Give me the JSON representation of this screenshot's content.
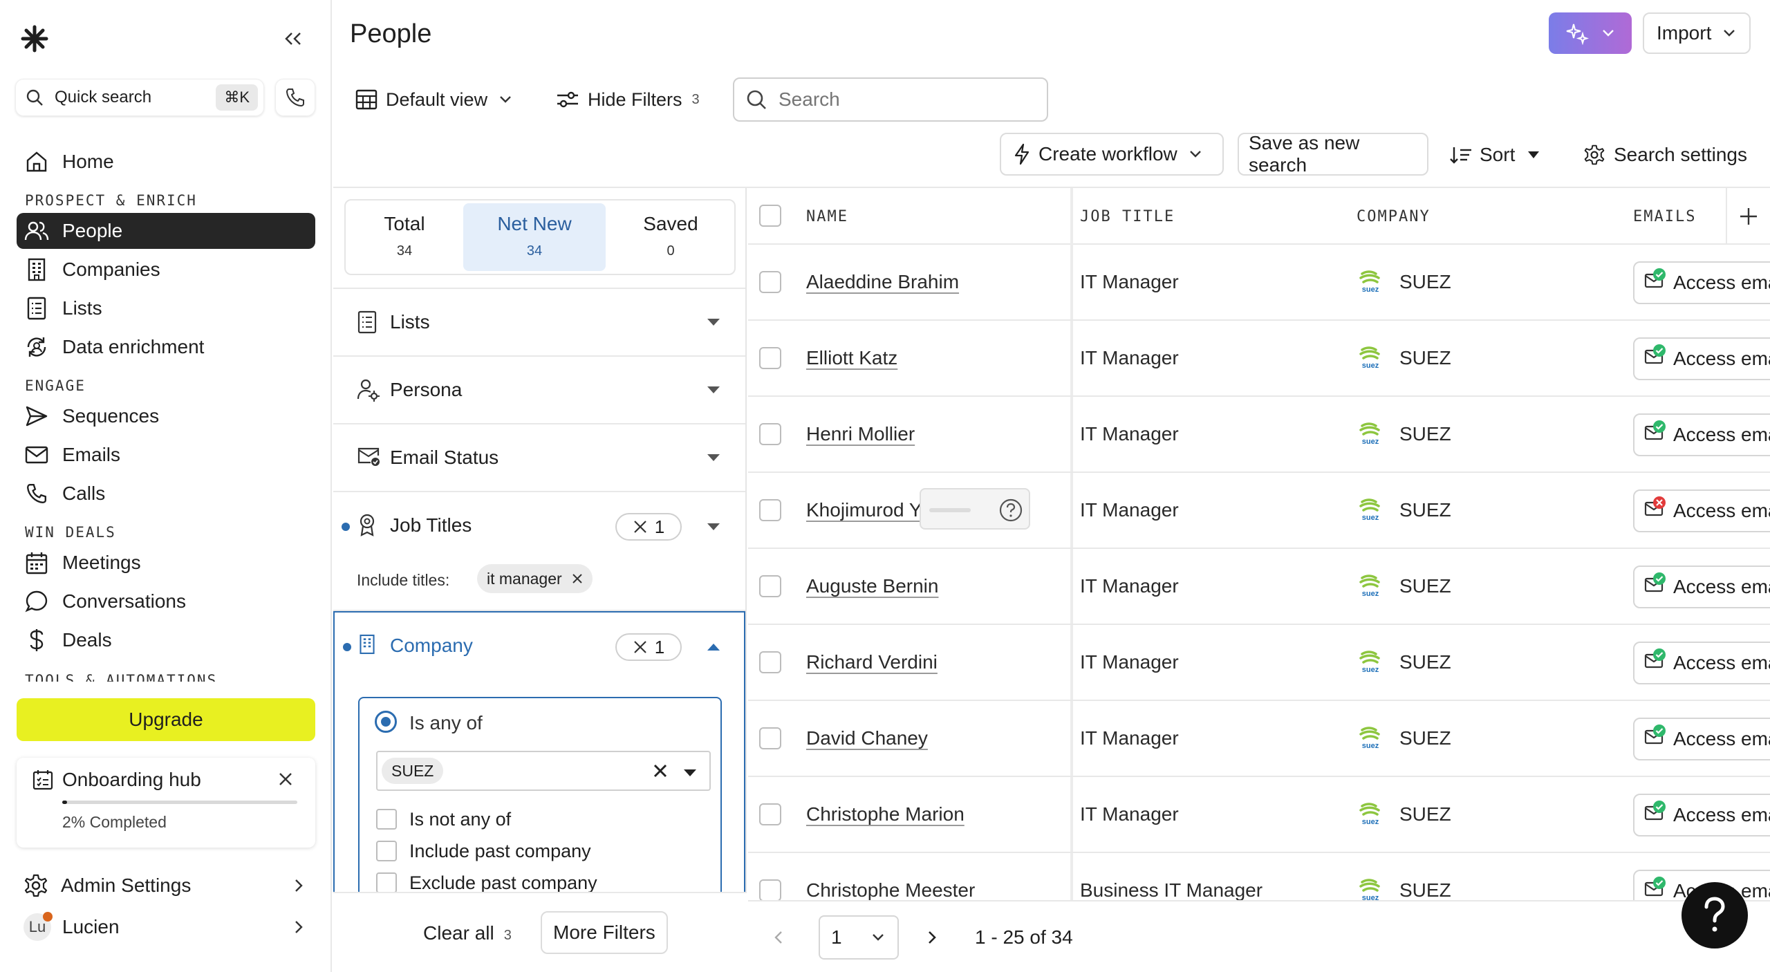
{
  "sidebar": {
    "quick_search_label": "Quick search",
    "quick_search_shortcut": "⌘K",
    "sections": {
      "prospect": "PROSPECT & ENRICH",
      "engage": "ENGAGE",
      "win": "WIN DEALS",
      "tools": "TOOLS & AUTOMATIONS"
    },
    "items": {
      "home": "Home",
      "people": "People",
      "companies": "Companies",
      "lists": "Lists",
      "data_enrichment": "Data enrichment",
      "sequences": "Sequences",
      "emails": "Emails",
      "calls": "Calls",
      "meetings": "Meetings",
      "conversations": "Conversations",
      "deals": "Deals"
    },
    "upgrade_label": "Upgrade",
    "upgrade_color": "#e8f021",
    "onboarding": {
      "title": "Onboarding hub",
      "progress_text": "2% Completed",
      "progress_fraction": 0.02
    },
    "admin_settings": "Admin Settings",
    "user": {
      "initials": "Lu",
      "name": "Lucien"
    }
  },
  "header": {
    "title": "People",
    "import_label": "Import",
    "ai_button_color": "#8b6fe0"
  },
  "toolbar": {
    "view_label": "Default view",
    "hide_filters_label": "Hide Filters",
    "hide_filters_count": "3",
    "search_placeholder": "Search",
    "create_workflow_label": "Create workflow",
    "save_search_label": "Save as new search",
    "sort_label": "Sort",
    "search_settings_label": "Search settings"
  },
  "filters": {
    "tabs": [
      {
        "label": "Total",
        "count": "34"
      },
      {
        "label": "Net New",
        "count": "34"
      },
      {
        "label": "Saved",
        "count": "0"
      }
    ],
    "lists": "Lists",
    "persona": "Persona",
    "email_status": "Email Status",
    "job_titles": {
      "label": "Job Titles",
      "count": "1",
      "include_label": "Include titles:",
      "chip": "it manager"
    },
    "company": {
      "label": "Company",
      "count": "1",
      "is_any_of": "Is any of",
      "chip": "SUEZ",
      "options": [
        "Is not any of",
        "Include past company",
        "Exclude past company"
      ]
    },
    "clear_all": "Clear all",
    "clear_count": "3",
    "more_filters": "More Filters"
  },
  "table": {
    "columns": [
      "NAME",
      "JOB TITLE",
      "COMPANY",
      "EMAILS"
    ],
    "access_label": "Access email",
    "rows": [
      {
        "name": "Alaeddine Brahim",
        "title": "IT Manager",
        "company": "SUEZ",
        "email_status": "verified"
      },
      {
        "name": "Elliott Katz",
        "title": "IT Manager",
        "company": "SUEZ",
        "email_status": "verified"
      },
      {
        "name": "Henri Mollier",
        "title": "IT Manager",
        "company": "SUEZ",
        "email_status": "verified"
      },
      {
        "name": "Khojimurod Y",
        "title": "IT Manager",
        "company": "SUEZ",
        "email_status": "unavailable"
      },
      {
        "name": "Auguste Bernin",
        "title": "IT Manager",
        "company": "SUEZ",
        "email_status": "verified"
      },
      {
        "name": "Richard Verdini",
        "title": "IT Manager",
        "company": "SUEZ",
        "email_status": "verified"
      },
      {
        "name": "David Chaney",
        "title": "IT Manager",
        "company": "SUEZ",
        "email_status": "verified"
      },
      {
        "name": "Christophe Marion",
        "title": "IT Manager",
        "company": "SUEZ",
        "email_status": "verified"
      },
      {
        "name": "Christophe Meester",
        "title": "Business IT Manager",
        "company": "SUEZ",
        "email_status": "verified"
      }
    ]
  },
  "pager": {
    "page": "1",
    "range": "1 - 25 of 34"
  }
}
